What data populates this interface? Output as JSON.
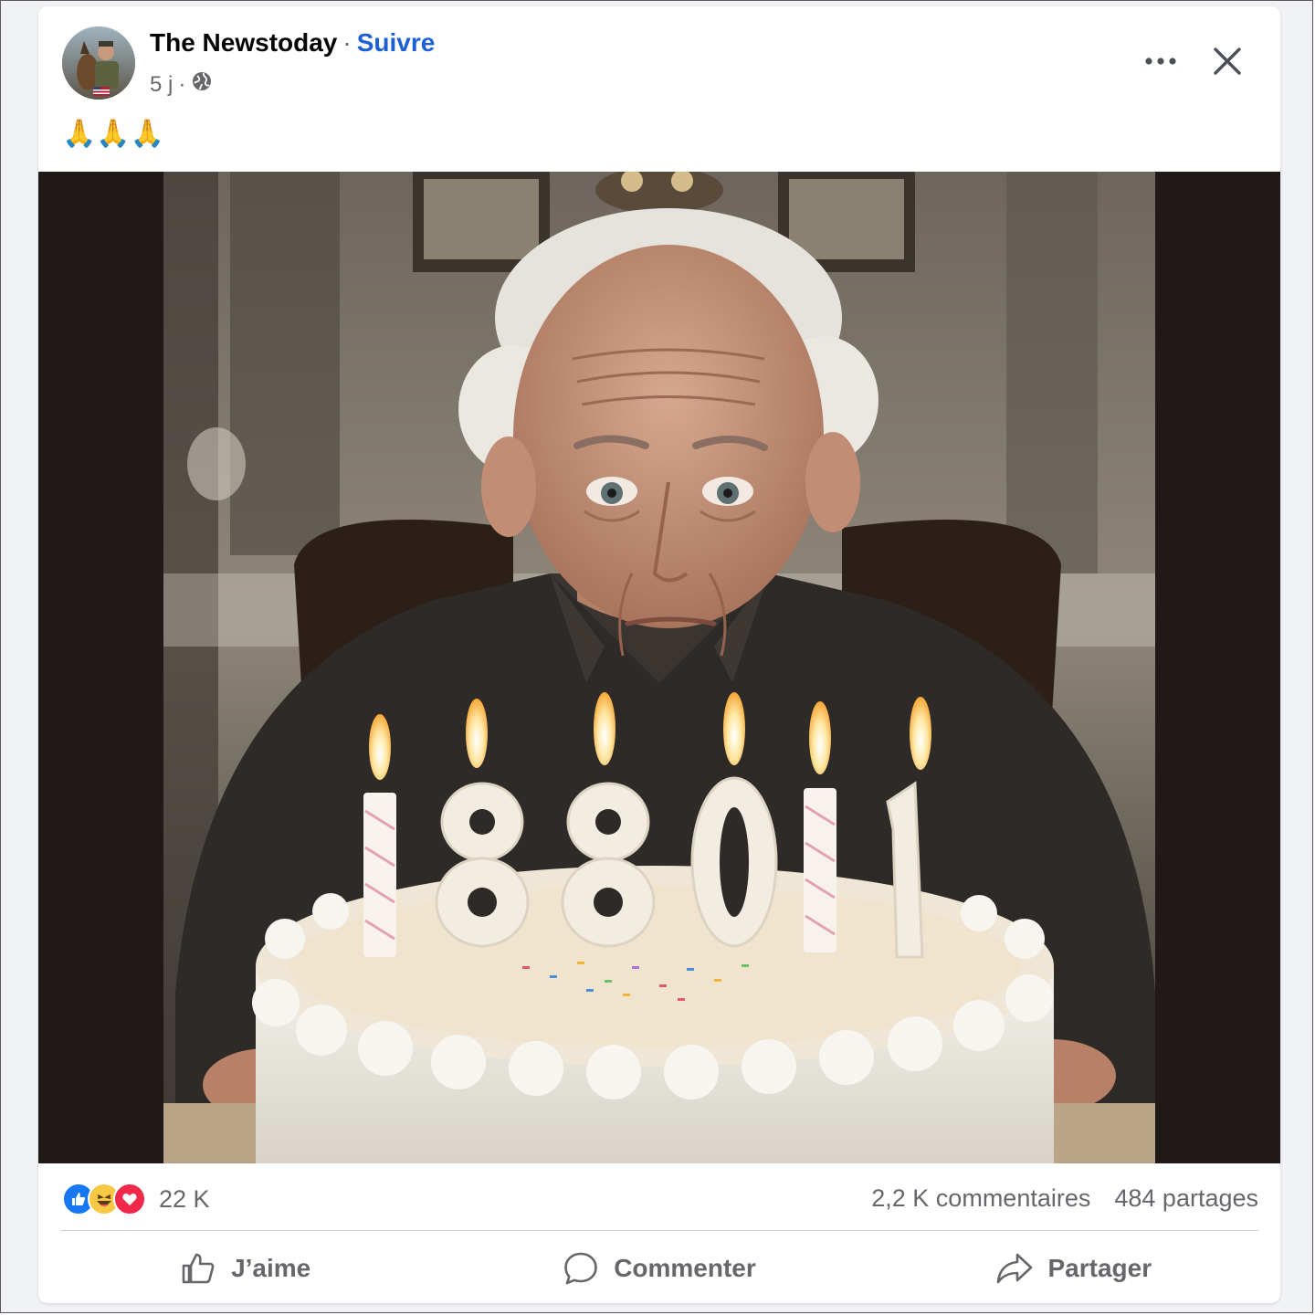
{
  "post": {
    "author": "The Newstoday",
    "separator": "·",
    "follow_label": "Suivre",
    "time": "5 j",
    "meta_separator": "·",
    "visibility_icon": "globe-icon",
    "caption": "🙏🙏🙏",
    "image_alt": "Elderly man behind a birthday cake with candles"
  },
  "header_icons": {
    "more": "more-dots-icon",
    "close": "close-icon"
  },
  "reactions": {
    "icons": [
      "like-icon",
      "haha-icon",
      "love-icon"
    ],
    "count": "22 K",
    "comments": "2,2 K commentaires",
    "shares": "484 partages"
  },
  "actions": {
    "like_label": "J’aime",
    "comment_label": "Commenter",
    "share_label": "Partager"
  },
  "colors": {
    "accent": "#1d60d6",
    "text_secondary": "#65676b",
    "like_blue": "#1877f2",
    "love_red": "#f02849",
    "haha_yellow": "#f7c843"
  }
}
